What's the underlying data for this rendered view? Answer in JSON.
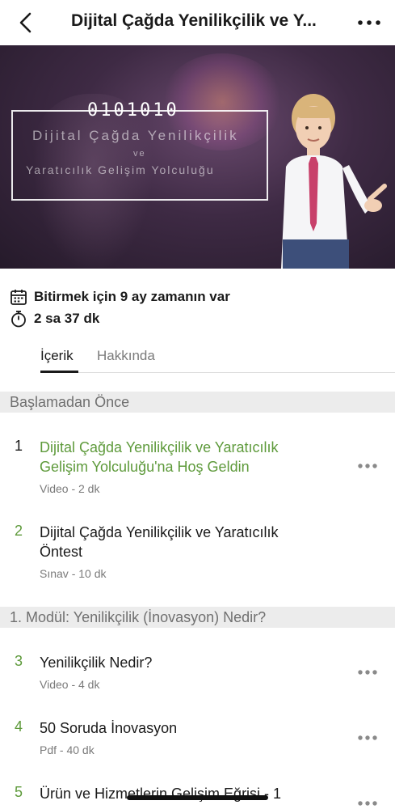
{
  "nav": {
    "back_icon": "chevron-left-icon",
    "title": "Dijital Çağda Yenilikçilik ve Y...",
    "more_icon": "more-horizontal-icon"
  },
  "hero": {
    "code": "0101010",
    "line1": "Dijital Çağda Yenilikçilik",
    "line2": "ve",
    "line3": "Yaratıcılık Gelişim Yolculuğu"
  },
  "meta": {
    "deadline": "Bitirmek için 9 ay zamanın var",
    "duration": "2 sa 37 dk"
  },
  "tabs": [
    {
      "label": "İçerik",
      "active": true
    },
    {
      "label": "Hakkında",
      "active": false
    }
  ],
  "sections": [
    {
      "title": "Başlamadan Önce"
    },
    {
      "title": "1. Modül: Yenilikçilik (İnovasyon) Nedir?"
    }
  ],
  "items": [
    {
      "num": "1",
      "name": "Dijital Çağda Yenilikçilik ve Yaratıcılık Gelişim Yolculuğu'na Hoş Geldin",
      "sub": "Video  -  2 dk",
      "state": "current"
    },
    {
      "num": "2",
      "name": "Dijital Çağda Yenilikçilik ve Yaratıcılık Öntest",
      "sub": "Sınav  -  10 dk",
      "state": "done"
    },
    {
      "num": "3",
      "name": "Yenilikçilik Nedir?",
      "sub": "Video  -  4 dk",
      "state": "done"
    },
    {
      "num": "4",
      "name": "50 Soruda İnovasyon",
      "sub": "Pdf  -  40 dk",
      "state": "done"
    },
    {
      "num": "5",
      "name": "Ürün ve Hizmetlerin Gelişim Eğrisi - 1",
      "sub": "",
      "state": "done"
    }
  ],
  "colors": {
    "accent_green": "#5e9a3b",
    "section_bg": "#ececec",
    "text": "#1a1a1a",
    "muted": "#7a7a7a"
  }
}
